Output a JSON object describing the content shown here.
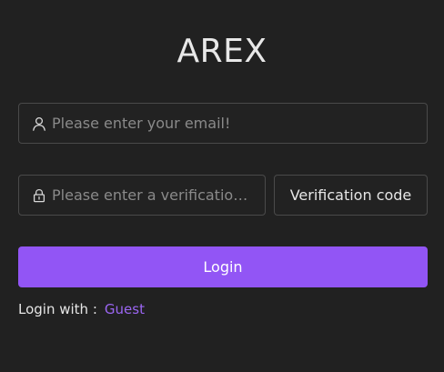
{
  "app": {
    "title": "AREX"
  },
  "form": {
    "email": {
      "value": "",
      "placeholder": "Please enter your email!",
      "icon": "user-icon"
    },
    "verification": {
      "value": "",
      "placeholder": "Please enter a verification code",
      "icon": "lock-icon"
    },
    "verification_button_label": "Verification code",
    "login_button_label": "Login"
  },
  "login_with": {
    "label": "Login with :",
    "guest_link": "Guest"
  },
  "colors": {
    "background": "#212121",
    "accent": "#9255f5",
    "link": "#9b66f2",
    "border": "#4a4a4a"
  }
}
